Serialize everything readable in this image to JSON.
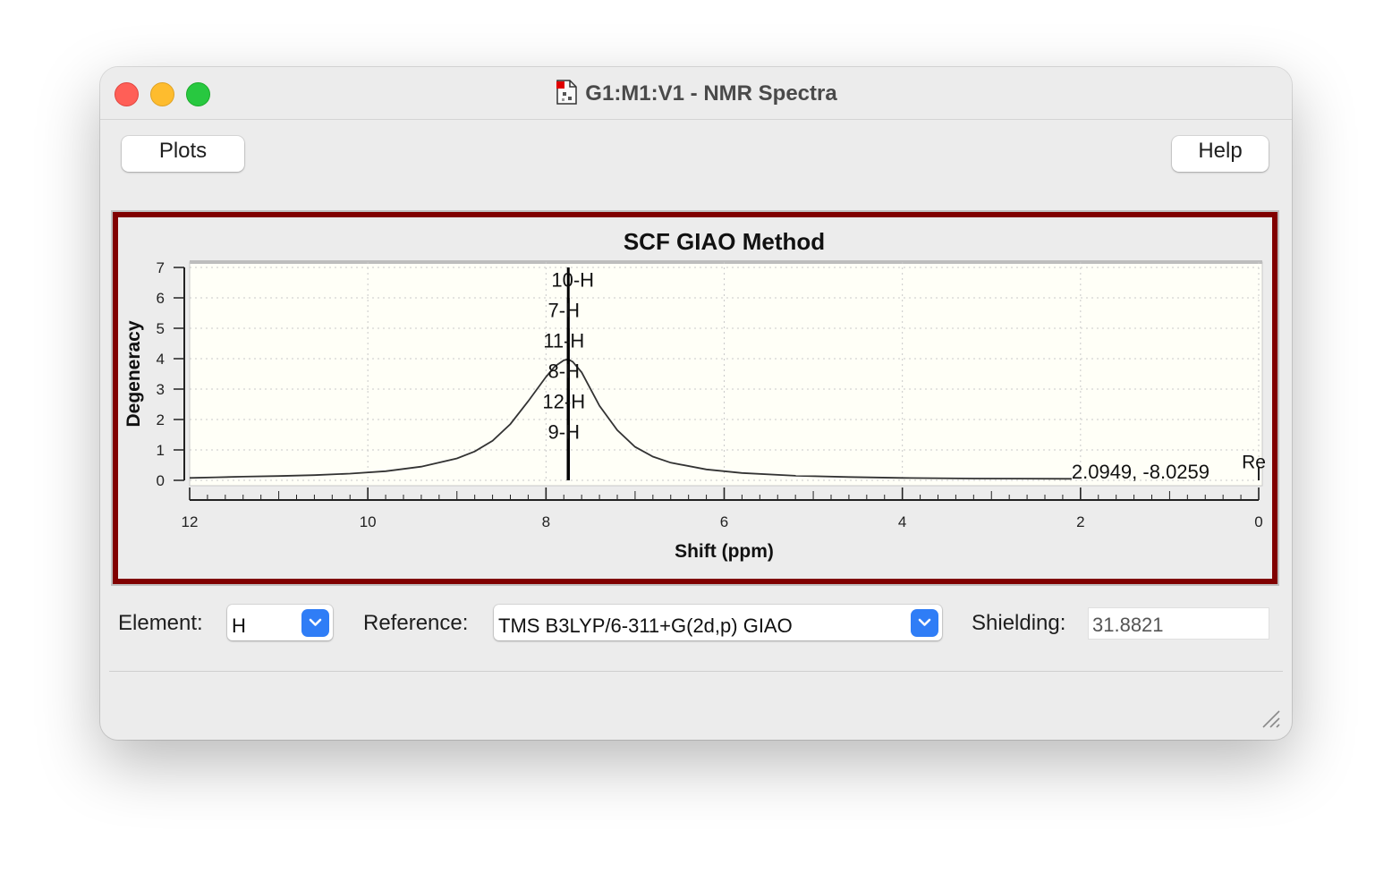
{
  "window": {
    "title": "G1:M1:V1 - NMR Spectra"
  },
  "toolbar": {
    "plots_label": "Plots",
    "help_label": "Help"
  },
  "chart_data": {
    "type": "line",
    "title": "SCF GIAO Method",
    "xlabel": "Shift (ppm)",
    "ylabel": "Degeneracy",
    "xlim": [
      12,
      0
    ],
    "ylim": [
      0,
      7
    ],
    "x_ticks": [
      "12",
      "10",
      "8",
      "6",
      "4",
      "2",
      "0"
    ],
    "y_ticks": [
      "0",
      "1",
      "2",
      "3",
      "4",
      "5",
      "6",
      "7"
    ],
    "grid": true,
    "background": "#fffff7",
    "series": [
      {
        "kind": "lorentzian-envelope",
        "x": [
          12.0,
          11.7,
          11.4,
          11.0,
          10.6,
          10.2,
          9.8,
          9.4,
          9.0,
          8.8,
          8.6,
          8.4,
          8.2,
          8.0,
          7.9,
          7.8,
          7.75,
          7.7,
          7.6,
          7.4,
          7.2,
          7.0,
          6.8,
          6.6,
          6.2,
          5.8,
          5.2,
          4.6,
          4.0,
          3.2,
          2.1
        ],
        "y": [
          0.08,
          0.1,
          0.12,
          0.14,
          0.17,
          0.22,
          0.3,
          0.45,
          0.72,
          0.95,
          1.3,
          1.85,
          2.6,
          3.4,
          3.75,
          3.95,
          3.98,
          3.9,
          3.55,
          2.45,
          1.65,
          1.1,
          0.78,
          0.58,
          0.36,
          0.24,
          0.15,
          0.11,
          0.08,
          0.06,
          0.05
        ]
      }
    ],
    "peaks": [
      {
        "x": 7.75,
        "y": 7
      },
      {
        "x": 7.75,
        "y": 6
      },
      {
        "x": 7.75,
        "y": 5
      },
      {
        "x": 7.75,
        "y": 4
      },
      {
        "x": 7.75,
        "y": 3
      },
      {
        "x": 7.75,
        "y": 2
      },
      {
        "x": 7.75,
        "y": 1
      }
    ],
    "peak_labels": [
      {
        "text": "10-H",
        "x": 7.7,
        "y": 6.6
      },
      {
        "text": "7-H",
        "x": 7.8,
        "y": 5.6
      },
      {
        "text": "11-H",
        "x": 7.8,
        "y": 4.6
      },
      {
        "text": "8-H",
        "x": 7.8,
        "y": 3.6
      },
      {
        "text": "12-H",
        "x": 7.8,
        "y": 2.6
      },
      {
        "text": "9-H",
        "x": 7.8,
        "y": 1.6
      }
    ],
    "reference_line_x": 0,
    "reference_label": "Re",
    "cursor_readout": "2.0949, -8.0259"
  },
  "controls": {
    "element_label": "Element:",
    "element_value": "H",
    "reference_label": "Reference:",
    "reference_value": "TMS B3LYP/6-311+G(2d,p) GIAO",
    "shielding_label": "Shielding:",
    "shielding_value": "31.8821"
  }
}
